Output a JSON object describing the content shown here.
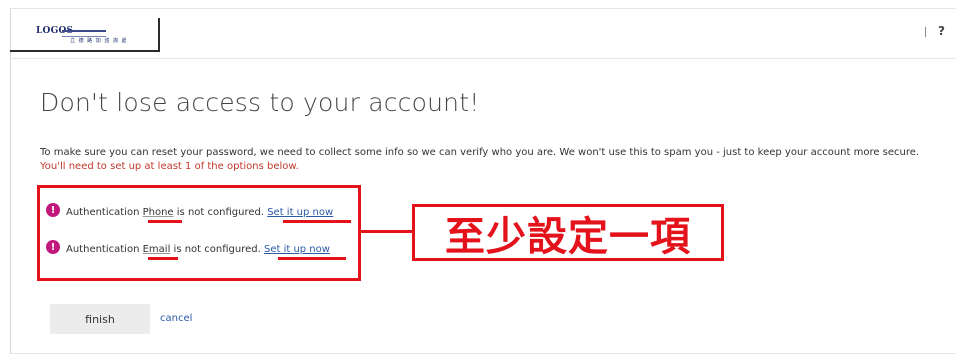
{
  "header": {
    "logo_text": "LOGOS",
    "logo_subtitle": "立 德 路 加 諮 詢 處",
    "help_label": "?"
  },
  "main": {
    "heading": "Don't lose access to your account!",
    "intro_text": "To make sure you can reset your password, we need to collect some info so we can verify who you are. We won't use this to spam you - just to keep your account more secure.",
    "intro_warning": "You'll need to set up at least 1 of the options below.",
    "auth_items": [
      {
        "prefix": "Authentication",
        "method": "Phone",
        "status": "is not configured.",
        "link": "Set it up now"
      },
      {
        "prefix": "Authentication",
        "method": "Email",
        "status": "is not configured.",
        "link": "Set it up now"
      }
    ],
    "finish_label": "finish",
    "cancel_label": "cancel"
  },
  "annotation": {
    "callout_text": "至少設定一項",
    "color": "#e3121b"
  },
  "icons": {
    "error_icon": "!"
  }
}
